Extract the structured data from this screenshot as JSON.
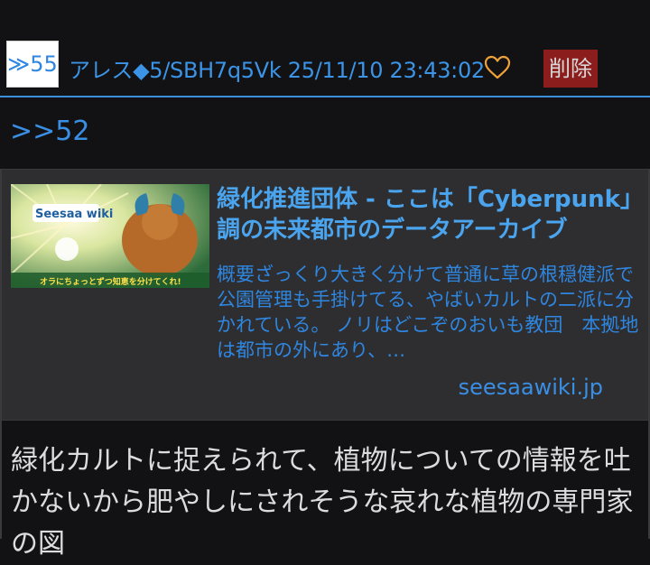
{
  "post": {
    "number": "≫55",
    "poster_line": "アレス◆5/SBH7q5Vk 25/11/10 23:43:02",
    "delete_label": "削除",
    "anchor": ">>52"
  },
  "link_card": {
    "thumbnail_logo": "Seesaa wiki",
    "thumbnail_caption": "オラにちょっとずつ知恵を分けてくれ!",
    "title": "緑化推進団体 - ここは「Cyberpunk」調の未来都市のデータアーカイブ",
    "description": "概要ざっくり大きく分けて普通に草の根穏健派で公園管理も手掛けてる、やばいカルトの二派に分かれている。 ノリはどこぞのおいも教団　本拠地は都市の外にあり、…",
    "domain": "seesaawiki.jp"
  },
  "body_text": "緑化カルトに捉えられて、植物についての情報を吐かないから肥やしにされそうな哀れな植物の専門家の図",
  "colors": {
    "background": "#121214",
    "link": "#3a8fe5",
    "delete_bg": "#8c1d1d",
    "heart": "#f0a23a"
  },
  "icons": {
    "favorite": "heart-icon"
  }
}
